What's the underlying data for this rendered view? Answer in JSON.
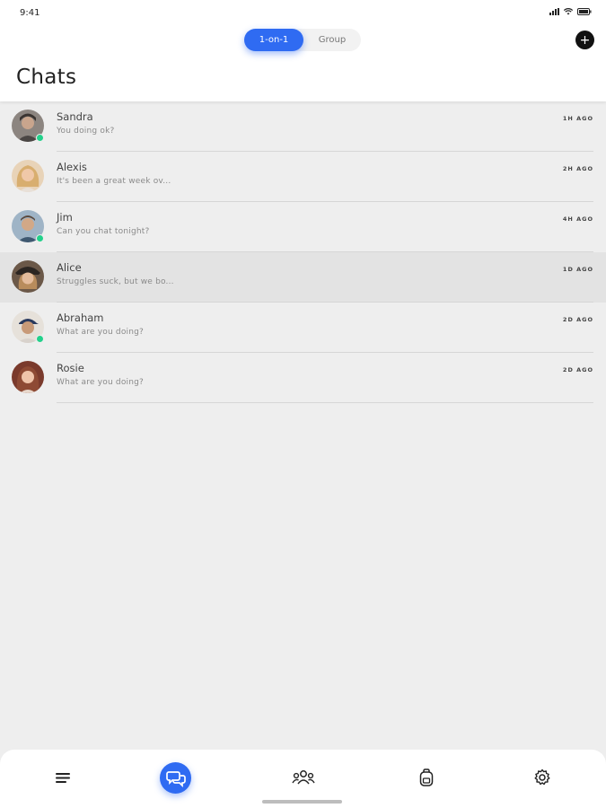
{
  "status_bar": {
    "time": "9:41"
  },
  "segmented": {
    "active": "1-on-1",
    "inactive": "Group"
  },
  "header": {
    "title": "Chats"
  },
  "chats": [
    {
      "name": "Sandra",
      "preview": "You doing ok?",
      "time": "1H AGO",
      "online": true,
      "avatar_color": "#7a6e66"
    },
    {
      "name": "Alexis",
      "preview": "It's been a great week ov...",
      "time": "2H AGO",
      "online": false,
      "avatar_color": "#d8b58a"
    },
    {
      "name": "Jim",
      "preview": "Can you chat tonight?",
      "time": "4H AGO",
      "online": true,
      "avatar_color": "#6d8aa3"
    },
    {
      "name": "Alice",
      "preview": "Struggles suck, but we bo...",
      "time": "1D AGO",
      "online": false,
      "avatar_color": "#7d6450"
    },
    {
      "name": "Abraham",
      "preview": "What are you doing?",
      "time": "2D AGO",
      "online": true,
      "avatar_color": "#c9b8a4"
    },
    {
      "name": "Rosie",
      "preview": "What are you doing?",
      "time": "2D AGO",
      "online": false,
      "avatar_color": "#9a5a46"
    }
  ],
  "tabbar": {
    "items": [
      {
        "icon": "menu-icon"
      },
      {
        "icon": "chat-bubbles-icon",
        "active": true
      },
      {
        "icon": "people-icon"
      },
      {
        "icon": "backpack-icon"
      },
      {
        "icon": "gear-icon"
      }
    ]
  },
  "colors": {
    "accent": "#2f6bf2",
    "online": "#23d18b",
    "background": "#eeeeee"
  }
}
